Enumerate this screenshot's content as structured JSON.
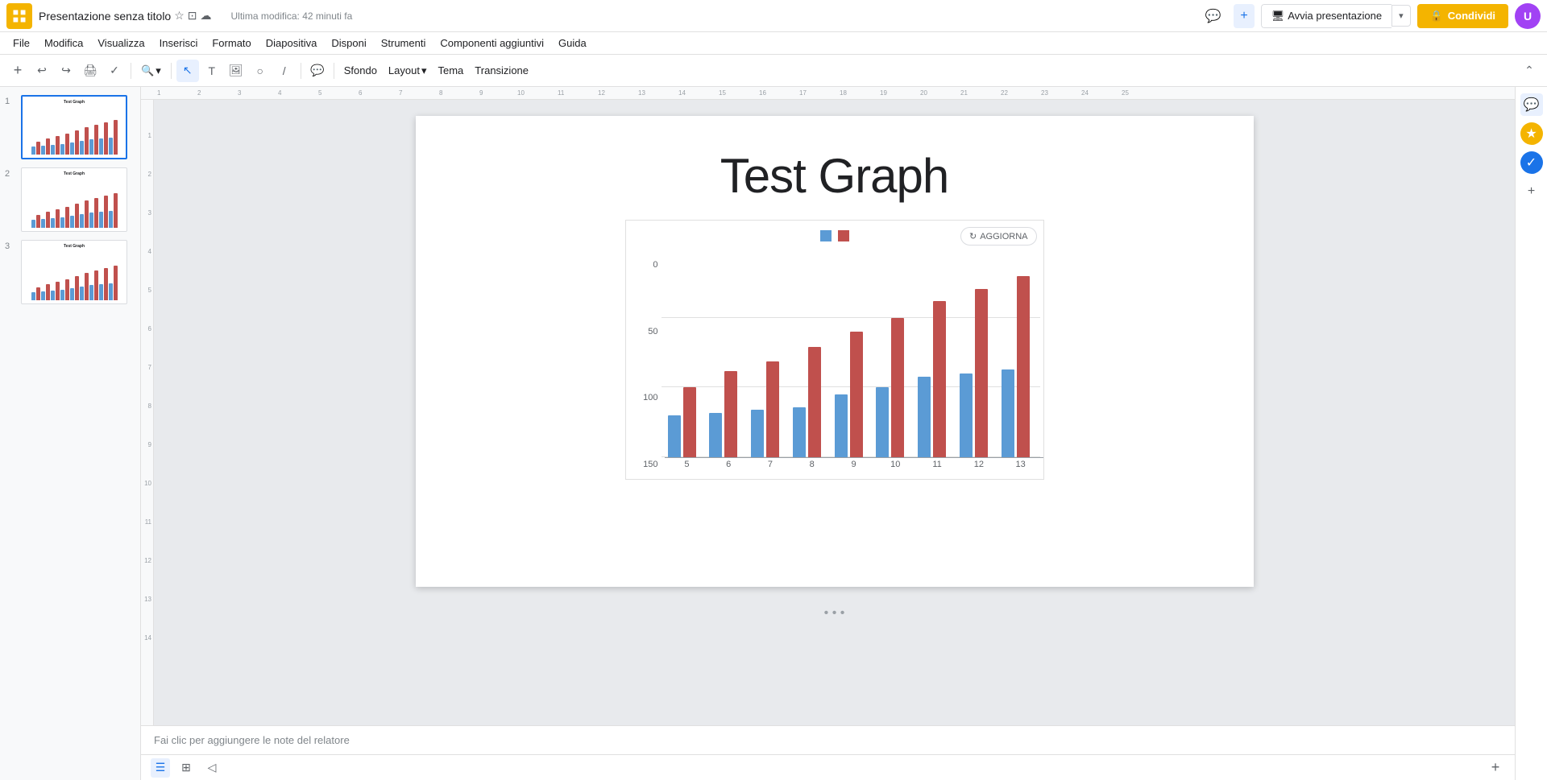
{
  "app": {
    "icon_color": "#f4b400",
    "title": "Presentazione senza titolo",
    "last_modified": "Ultima modifica: 42 minuti fa"
  },
  "title_icons": [
    "☆",
    "□",
    "☁"
  ],
  "menu": {
    "items": [
      "File",
      "Modifica",
      "Visualizza",
      "Inserisci",
      "Formato",
      "Diapositiva",
      "Disponi",
      "Strumenti",
      "Componenti aggiuntivi",
      "Guida"
    ]
  },
  "toolbar": {
    "sfondo_label": "Sfondo",
    "layout_label": "Layout",
    "tema_label": "Tema",
    "transizione_label": "Transizione"
  },
  "top_right": {
    "present_label": "Avvia presentazione",
    "share_label": "Condividi",
    "share_icon": "🔒"
  },
  "slides": [
    {
      "number": "1",
      "title": "Test Graph",
      "active": true
    },
    {
      "number": "2",
      "title": "Test Graph",
      "active": false
    },
    {
      "number": "3",
      "title": "Test Graph",
      "active": false
    }
  ],
  "slide": {
    "title": "Test Graph",
    "chart": {
      "legend": [
        {
          "color": "#5b9bd5",
          "label": ""
        },
        {
          "color": "#c0504d",
          "label": ""
        }
      ],
      "update_label": "AGGIORNA",
      "y_labels": [
        "0",
        "50",
        "100",
        "150"
      ],
      "x_labels": [
        "5",
        "6",
        "7",
        "8",
        "9",
        "10",
        "11",
        "12",
        "13"
      ],
      "bars": [
        {
          "x": "5",
          "blue": 30,
          "red": 50
        },
        {
          "x": "6",
          "blue": 32,
          "red": 62
        },
        {
          "x": "7",
          "blue": 34,
          "red": 69
        },
        {
          "x": "8",
          "blue": 36,
          "red": 79
        },
        {
          "x": "9",
          "blue": 45,
          "red": 90
        },
        {
          "x": "10",
          "blue": 50,
          "red": 100
        },
        {
          "x": "11",
          "blue": 58,
          "red": 112
        },
        {
          "x": "12",
          "blue": 60,
          "red": 121
        },
        {
          "x": "13",
          "blue": 63,
          "red": 130
        }
      ],
      "max_value": 150
    }
  },
  "notes": {
    "placeholder": "Fai clic per aggiungere le note del relatore"
  },
  "right_panel": {
    "icons": [
      "💬",
      "⭐",
      "✓",
      "➕"
    ]
  }
}
